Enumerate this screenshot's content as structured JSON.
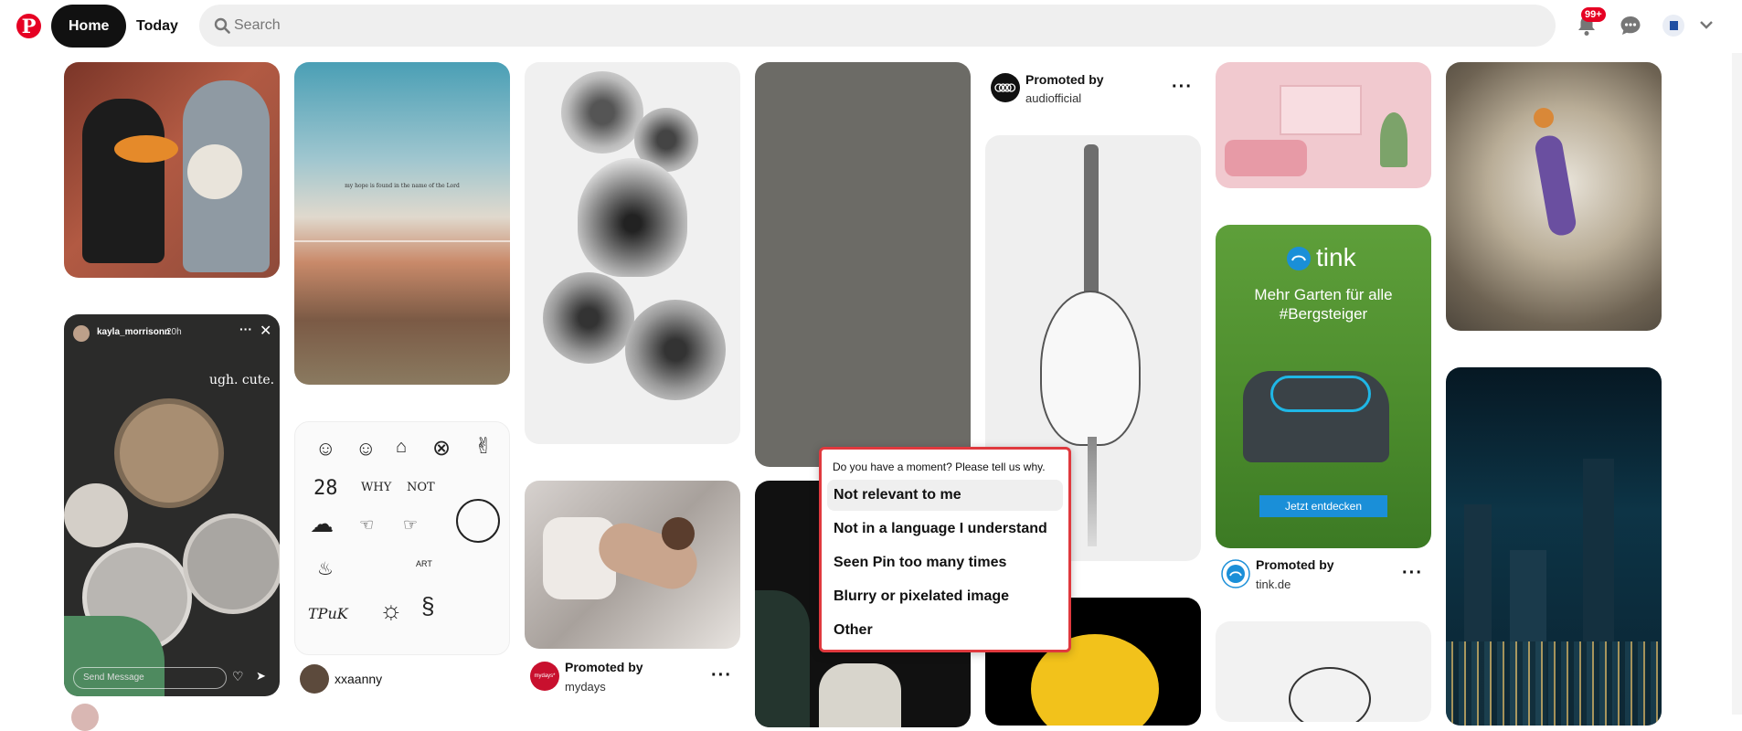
{
  "header": {
    "logo": "P",
    "home": "Home",
    "today": "Today",
    "search_placeholder": "Search",
    "notifications_badge": "99+"
  },
  "pins": {
    "story": {
      "username": "kayla_morrisonn",
      "time": "20h",
      "caption": "ugh. cute.",
      "reply_placeholder": "Send Message"
    },
    "ocean": {
      "caption": "my hope is found in the name of the Lord"
    },
    "doodles": {
      "labels": [
        "28",
        "WHY",
        "NOT",
        "ART",
        "TPuK"
      ]
    },
    "xxaanny": {
      "name": "xxaanny"
    },
    "mydays": {
      "promoted": "Promoted by",
      "brand": "mydays",
      "logo_text": "mydays*"
    },
    "audi": {
      "promoted": "Promoted by",
      "brand": "audiofficial"
    },
    "tink_ad": {
      "logo": "tink",
      "headline": "Mehr Garten für alle #Bergsteiger",
      "cta": "Jetzt entdecken"
    },
    "tink": {
      "promoted": "Promoted by",
      "brand": "tink.de"
    }
  },
  "feedback_menu": {
    "question": "Do you have a moment? Please tell us why.",
    "options": [
      "Not relevant to me",
      "Not in a language I understand",
      "Seen Pin too many times",
      "Blurry or pixelated image",
      "Other"
    ]
  },
  "colors": {
    "brand_red": "#e60023",
    "menu_border": "#e0393e"
  }
}
